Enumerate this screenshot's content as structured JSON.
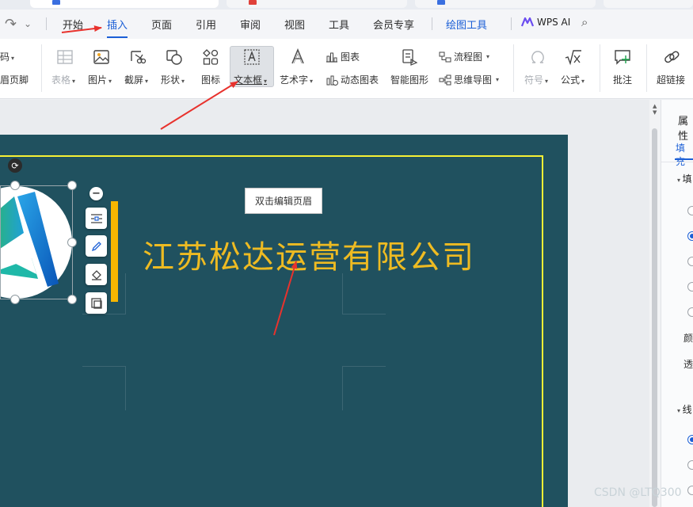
{
  "menu": {
    "items": [
      "开始",
      "插入",
      "页面",
      "引用",
      "审阅",
      "视图",
      "工具",
      "会员专享",
      "绘图工具"
    ],
    "active": "插入",
    "wps_ai": "WPS AI"
  },
  "ribbon": {
    "left_cut": [
      "码",
      "眉页脚"
    ],
    "table": "表格",
    "picture": "图片",
    "screenshot": "截屏",
    "shape": "形状",
    "icon": "图标",
    "textbox": "文本框",
    "wordart": "艺术字",
    "chart": "图表",
    "dynamic_chart": "动态图表",
    "smart_graphic": "智能图形",
    "flowchart": "流程图",
    "mindmap": "思维导图",
    "symbol": "符号",
    "formula": "公式",
    "comment": "批注",
    "hyperlink": "超链接"
  },
  "document": {
    "header_hint": "双击编辑页眉",
    "company_name": "江苏松达运营有限公司"
  },
  "panel": {
    "title": "属性",
    "tab": "填充",
    "section_fill": "填",
    "label_color": "颜",
    "label_transparency": "透",
    "section_line": "线"
  },
  "watermark": "CSDN @LTQ300",
  "colors": {
    "accent": "#1b5fd6",
    "page_bg": "#20515f",
    "company_text": "#eebb22",
    "arrow": "#e8322d"
  }
}
